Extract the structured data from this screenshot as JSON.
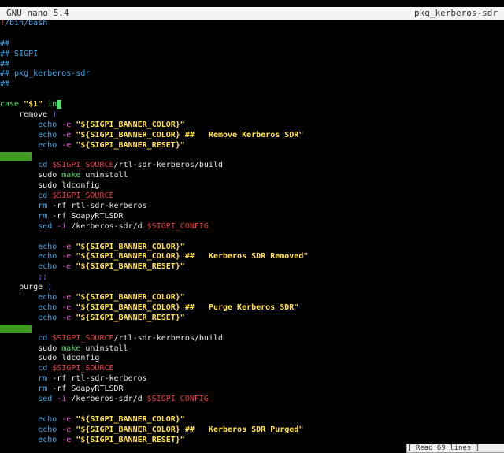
{
  "titlebar": {
    "version": "GNU nano 5.4",
    "filename": "pkg_kerberos-sdr"
  },
  "editor": {
    "lines": [
      {
        "segments": [
          {
            "t": "!",
            "c": "red"
          },
          {
            "t": "/bin/bash",
            "c": "cyan"
          }
        ]
      },
      {
        "segments": []
      },
      {
        "segments": [
          {
            "t": "##",
            "c": "cyan"
          }
        ]
      },
      {
        "segments": [
          {
            "t": "## SIGPI",
            "c": "cyan"
          }
        ]
      },
      {
        "segments": [
          {
            "t": "##",
            "c": "cyan"
          }
        ]
      },
      {
        "segments": [
          {
            "t": "## pkg_kerberos-sdr",
            "c": "cyan"
          }
        ]
      },
      {
        "segments": [
          {
            "t": "##",
            "c": "cyan"
          }
        ]
      },
      {
        "segments": []
      },
      {
        "segments": [
          {
            "t": "case ",
            "c": "kw"
          },
          {
            "t": "\"$1\"",
            "c": "str"
          },
          {
            "t": " in",
            "c": "kw"
          },
          {
            "t": " ",
            "c": "cursor"
          }
        ]
      },
      {
        "segments": [
          {
            "t": "    remove ",
            "c": "text"
          },
          {
            "t": ")",
            "c": "blue"
          }
        ]
      },
      {
        "segments": [
          {
            "t": "        ",
            "c": "text"
          },
          {
            "t": "echo",
            "c": "cyan"
          },
          {
            "t": " -e ",
            "c": "mag"
          },
          {
            "t": "\"${SIGPI_BANNER_COLOR}\"",
            "c": "str"
          }
        ]
      },
      {
        "segments": [
          {
            "t": "        ",
            "c": "text"
          },
          {
            "t": "echo",
            "c": "cyan"
          },
          {
            "t": " -e ",
            "c": "mag"
          },
          {
            "t": "\"${SIGPI_BANNER_COLOR} ##   Remove Kerberos SDR\"",
            "c": "str"
          }
        ]
      },
      {
        "segments": [
          {
            "t": "        ",
            "c": "text"
          },
          {
            "t": "echo",
            "c": "cyan"
          },
          {
            "t": " -e ",
            "c": "mag"
          },
          {
            "t": "\"${SIGPI_BANNER_RESET}\"",
            "c": "str"
          }
        ]
      },
      {
        "segments": [],
        "marker": true
      },
      {
        "segments": [
          {
            "t": "        ",
            "c": "text"
          },
          {
            "t": "cd",
            "c": "cyan"
          },
          {
            "t": " ",
            "c": "text"
          },
          {
            "t": "$SIGPI_SOURCE",
            "c": "var"
          },
          {
            "t": "/rtl-sdr-kerberos/build",
            "c": "text"
          }
        ]
      },
      {
        "segments": [
          {
            "t": "        sudo ",
            "c": "text"
          },
          {
            "t": "make",
            "c": "kw"
          },
          {
            "t": " uninstall",
            "c": "text"
          }
        ]
      },
      {
        "segments": [
          {
            "t": "        sudo ldconfig",
            "c": "text"
          }
        ]
      },
      {
        "segments": [
          {
            "t": "        ",
            "c": "text"
          },
          {
            "t": "cd",
            "c": "cyan"
          },
          {
            "t": " ",
            "c": "text"
          },
          {
            "t": "$SIGPI_SOURCE",
            "c": "var"
          }
        ]
      },
      {
        "segments": [
          {
            "t": "        ",
            "c": "text"
          },
          {
            "t": "rm",
            "c": "cyan"
          },
          {
            "t": " -rf rtl-sdr-kerberos",
            "c": "text"
          }
        ]
      },
      {
        "segments": [
          {
            "t": "        ",
            "c": "text"
          },
          {
            "t": "rm",
            "c": "cyan"
          },
          {
            "t": " -rf SoapyRTLSDR",
            "c": "text"
          }
        ]
      },
      {
        "segments": [
          {
            "t": "        ",
            "c": "text"
          },
          {
            "t": "sed",
            "c": "cyan"
          },
          {
            "t": " -i ",
            "c": "mag"
          },
          {
            "t": "/kerberos-sdr/d ",
            "c": "text"
          },
          {
            "t": "$SIGPI_CONFIG",
            "c": "var"
          }
        ]
      },
      {
        "segments": []
      },
      {
        "segments": [
          {
            "t": "        ",
            "c": "text"
          },
          {
            "t": "echo",
            "c": "cyan"
          },
          {
            "t": " -e ",
            "c": "mag"
          },
          {
            "t": "\"${SIGPI_BANNER_COLOR}\"",
            "c": "str"
          }
        ]
      },
      {
        "segments": [
          {
            "t": "        ",
            "c": "text"
          },
          {
            "t": "echo",
            "c": "cyan"
          },
          {
            "t": " -e ",
            "c": "mag"
          },
          {
            "t": "\"${SIGPI_BANNER_COLOR} ##   Kerberos SDR Removed\"",
            "c": "str"
          }
        ]
      },
      {
        "segments": [
          {
            "t": "        ",
            "c": "text"
          },
          {
            "t": "echo",
            "c": "cyan"
          },
          {
            "t": " -e ",
            "c": "mag"
          },
          {
            "t": "\"${SIGPI_BANNER_RESET}\"",
            "c": "str"
          }
        ]
      },
      {
        "segments": [
          {
            "t": "        ",
            "c": "text"
          },
          {
            "t": ";;",
            "c": "blue"
          }
        ]
      },
      {
        "segments": [
          {
            "t": "    purge ",
            "c": "text"
          },
          {
            "t": ")",
            "c": "blue"
          }
        ]
      },
      {
        "segments": [
          {
            "t": "        ",
            "c": "text"
          },
          {
            "t": "echo",
            "c": "cyan"
          },
          {
            "t": " -e ",
            "c": "mag"
          },
          {
            "t": "\"${SIGPI_BANNER_COLOR}\"",
            "c": "str"
          }
        ]
      },
      {
        "segments": [
          {
            "t": "        ",
            "c": "text"
          },
          {
            "t": "echo",
            "c": "cyan"
          },
          {
            "t": " -e ",
            "c": "mag"
          },
          {
            "t": "\"${SIGPI_BANNER_COLOR} ##   Purge Kerberos SDR\"",
            "c": "str"
          }
        ]
      },
      {
        "segments": [
          {
            "t": "        ",
            "c": "text"
          },
          {
            "t": "echo",
            "c": "cyan"
          },
          {
            "t": " -e ",
            "c": "mag"
          },
          {
            "t": "\"${SIGPI_BANNER_RESET}\"",
            "c": "str"
          }
        ]
      },
      {
        "segments": [],
        "marker": true
      },
      {
        "segments": [
          {
            "t": "        ",
            "c": "text"
          },
          {
            "t": "cd",
            "c": "cyan"
          },
          {
            "t": " ",
            "c": "text"
          },
          {
            "t": "$SIGPI_SOURCE",
            "c": "var"
          },
          {
            "t": "/rtl-sdr-kerberos/build",
            "c": "text"
          }
        ]
      },
      {
        "segments": [
          {
            "t": "        sudo ",
            "c": "text"
          },
          {
            "t": "make",
            "c": "kw"
          },
          {
            "t": " uninstall",
            "c": "text"
          }
        ]
      },
      {
        "segments": [
          {
            "t": "        sudo ldconfig",
            "c": "text"
          }
        ]
      },
      {
        "segments": [
          {
            "t": "        ",
            "c": "text"
          },
          {
            "t": "cd",
            "c": "cyan"
          },
          {
            "t": " ",
            "c": "text"
          },
          {
            "t": "$SIGPI_SOURCE",
            "c": "var"
          }
        ]
      },
      {
        "segments": [
          {
            "t": "        ",
            "c": "text"
          },
          {
            "t": "rm",
            "c": "cyan"
          },
          {
            "t": " -rf rtl-sdr-kerberos",
            "c": "text"
          }
        ]
      },
      {
        "segments": [
          {
            "t": "        ",
            "c": "text"
          },
          {
            "t": "rm",
            "c": "cyan"
          },
          {
            "t": " -rf SoapyRTLSDR",
            "c": "text"
          }
        ]
      },
      {
        "segments": [
          {
            "t": "        ",
            "c": "text"
          },
          {
            "t": "sed",
            "c": "cyan"
          },
          {
            "t": " -i ",
            "c": "mag"
          },
          {
            "t": "/kerberos-sdr/d ",
            "c": "text"
          },
          {
            "t": "$SIGPI_CONFIG",
            "c": "var"
          }
        ]
      },
      {
        "segments": []
      },
      {
        "segments": [
          {
            "t": "        ",
            "c": "text"
          },
          {
            "t": "echo",
            "c": "cyan"
          },
          {
            "t": " -e ",
            "c": "mag"
          },
          {
            "t": "\"${SIGPI_BANNER_COLOR}\"",
            "c": "str"
          }
        ]
      },
      {
        "segments": [
          {
            "t": "        ",
            "c": "text"
          },
          {
            "t": "echo",
            "c": "cyan"
          },
          {
            "t": " -e ",
            "c": "mag"
          },
          {
            "t": "\"${SIGPI_BANNER_COLOR} ##   Kerberos SDR Purged\"",
            "c": "str"
          }
        ]
      },
      {
        "segments": [
          {
            "t": "        ",
            "c": "text"
          },
          {
            "t": "echo",
            "c": "cyan"
          },
          {
            "t": " -e ",
            "c": "mag"
          },
          {
            "t": "\"${SIGPI_BANNER_RESET}\"",
            "c": "str"
          }
        ]
      }
    ]
  },
  "statusbar": {
    "message": "[ Read 69 lines ]"
  },
  "colors": {
    "background": "#000000",
    "text": "#e6e6e6",
    "comment": "#3aa6e8",
    "keyword": "#4fe06a",
    "string": "#ffe04a",
    "variable": "#ef3a3a",
    "option": "#e84fd8",
    "marker": "#3e9b1f"
  }
}
